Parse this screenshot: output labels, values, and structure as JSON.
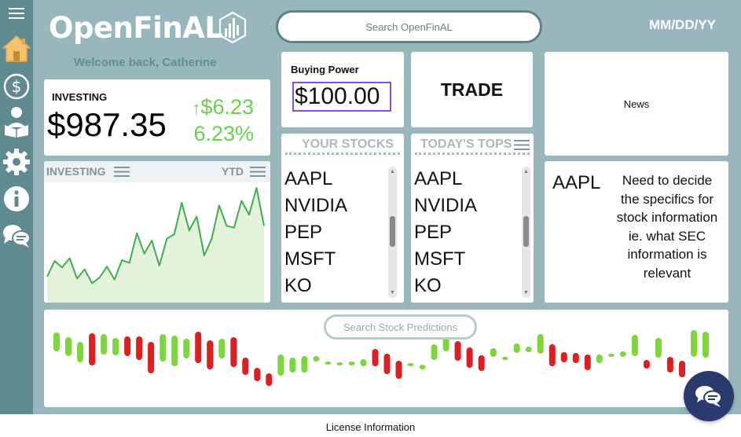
{
  "app": {
    "name": "OpenFinAL",
    "welcome": "Welcome back, Catherine",
    "date": "MM/DD/YY"
  },
  "search": {
    "placeholder": "Search OpenFinAL"
  },
  "sidebar": {
    "items": [
      {
        "icon": "menu-icon"
      },
      {
        "icon": "home-icon"
      },
      {
        "icon": "dollar-icon"
      },
      {
        "icon": "learn-icon"
      },
      {
        "icon": "gear-icon"
      },
      {
        "icon": "info-icon"
      },
      {
        "icon": "chat-icon"
      }
    ]
  },
  "investing": {
    "label": "INVESTING",
    "value": "$987.35",
    "change_amount": "$6.23",
    "change_percent": "6.23%"
  },
  "investing_chart": {
    "title": "INVESTING",
    "period": "YTD",
    "chart_data": {
      "type": "area",
      "values": [
        28,
        45,
        38,
        48,
        26,
        36,
        21,
        27,
        39,
        25,
        46,
        43,
        75,
        53,
        67,
        40,
        69,
        74,
        108,
        78,
        93,
        51,
        69,
        105,
        83,
        81,
        110,
        95,
        124,
        83
      ]
    }
  },
  "buying_power": {
    "label": "Buying Power",
    "value": "$100.00"
  },
  "trade": {
    "label": "TRADE"
  },
  "news": {
    "label": "News"
  },
  "your_stocks": {
    "title": "YOUR STOCKS",
    "items": [
      "AAPL",
      "NVIDIA",
      "PEP",
      "MSFT",
      "KO"
    ]
  },
  "todays_tops": {
    "title": "TODAY'S TOPS",
    "items": [
      "AAPL",
      "NVIDIA",
      "PEP",
      "MSFT",
      "KO"
    ]
  },
  "stock_detail": {
    "ticker": "AAPL",
    "note": "Need to decide the specifics for stock information ie. what SEC information is relevant"
  },
  "predictions": {
    "placeholder": "Search Stock Predictions",
    "colors": {
      "up": "#7ed63d",
      "down": "#dd1f1f"
    },
    "candles": [
      [
        "up",
        -29,
        -53
      ],
      [
        "up",
        -35,
        -59
      ],
      [
        "up",
        -41,
        -67
      ],
      [
        "down",
        -30,
        -71
      ],
      [
        "up",
        -31,
        -57
      ],
      [
        "up",
        -36,
        -58
      ],
      [
        "down",
        -34,
        -59
      ],
      [
        "down",
        -34,
        -64
      ],
      [
        "down",
        -41,
        -81
      ],
      [
        "up",
        -31,
        -66
      ],
      [
        "up",
        -33,
        -72
      ],
      [
        "up",
        -37,
        -62
      ],
      [
        "down",
        -28,
        -68
      ],
      [
        "down",
        -39,
        -76
      ],
      [
        "up",
        -37,
        -62
      ],
      [
        "down",
        -35,
        -73
      ],
      [
        "down",
        -61,
        -83
      ],
      [
        "down",
        -74,
        -91
      ],
      [
        "down",
        -81,
        -97
      ],
      [
        "up",
        -57,
        -84
      ],
      [
        "up",
        -61,
        -80
      ],
      [
        "up",
        -59,
        -80
      ],
      [
        "up",
        -59,
        -66
      ],
      [
        "up",
        -66,
        -67
      ],
      [
        "up",
        -67,
        -69
      ],
      [
        "up",
        -66,
        -71
      ],
      [
        "up",
        -63,
        -72
      ],
      [
        "down",
        -50,
        -72
      ],
      [
        "down",
        -56,
        -82
      ],
      [
        "down",
        -65,
        -88
      ],
      [
        "up",
        -68,
        -70
      ],
      [
        "up",
        -70,
        -76
      ],
      [
        "up",
        -44,
        -64
      ],
      [
        "up",
        -29,
        -53
      ],
      [
        "down",
        -40,
        -65
      ],
      [
        "down",
        -48,
        -74
      ],
      [
        "down",
        -58,
        -78
      ],
      [
        "up",
        -49,
        -60
      ],
      [
        "up",
        -60,
        -64
      ],
      [
        "up",
        -43,
        -55
      ],
      [
        "up",
        -47,
        -54
      ],
      [
        "up",
        -31,
        -56
      ],
      [
        "down",
        -44,
        -72
      ],
      [
        "down",
        -54,
        -67
      ],
      [
        "down",
        -55,
        -68
      ],
      [
        "down",
        -57,
        -77
      ],
      [
        "up",
        -57,
        -68
      ],
      [
        "up",
        -56,
        -60
      ],
      [
        "up",
        -53,
        -60
      ],
      [
        "up",
        -32,
        -59
      ],
      [
        "down",
        -64,
        -75
      ],
      [
        "up",
        -36,
        -61
      ],
      [
        "down",
        -60,
        -80
      ],
      [
        "down",
        -65,
        -86
      ],
      [
        "up",
        -26,
        -60
      ],
      [
        "up",
        -28,
        -61
      ]
    ]
  }
}
